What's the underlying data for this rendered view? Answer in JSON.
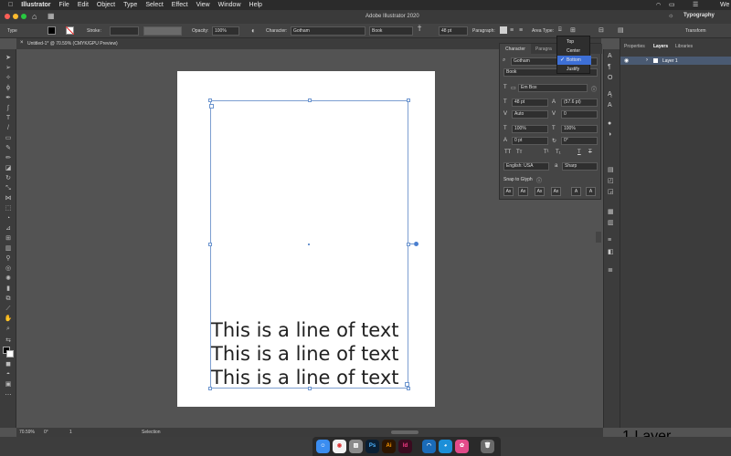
{
  "menubar": {
    "app": "Illustrator",
    "items": [
      "File",
      "Edit",
      "Object",
      "Type",
      "Select",
      "Effect",
      "View",
      "Window",
      "Help"
    ],
    "workspace": "Typography",
    "right_end": "We"
  },
  "titlebar": {
    "title": "Adobe Illustrator 2020"
  },
  "controlbar": {
    "type_label": "Type",
    "stroke_label": "Stroke:",
    "opacity_label": "Opacity:",
    "opacity_value": "100%",
    "character_label": "Character:",
    "font": "Gotham",
    "font_style": "Book",
    "font_size": "48 pt",
    "paragraph_label": "Paragraph:",
    "area_type_label": "Area Type:",
    "transform_label": "Transform"
  },
  "document": {
    "tab_title": "Untitled-1* @ 70.59% (CMYK/GPU Preview)",
    "text_lines": [
      "This is a line of text",
      "This is a line of text",
      "This is a line of text"
    ]
  },
  "dropdown": {
    "items": [
      "Top",
      "Center",
      "Bottom",
      "Justify"
    ],
    "selected": "Bottom"
  },
  "character_panel": {
    "tab_character": "Character",
    "tab_paragraph": "Paragra",
    "font": "Gotham",
    "style": "Book",
    "em_box": "Em Box",
    "size": "48 pt",
    "leading": "(57.6 pt)",
    "kerning": "Auto",
    "tracking": "0",
    "vscale": "100%",
    "hscale": "100%",
    "baseline": "0 pt",
    "rotation": "0°",
    "language": "English: USA",
    "antialias": "Sharp",
    "snap_label": "Snap to Glyph",
    "typographic_caps": [
      "TT",
      "Tт",
      "T¹",
      "T₁",
      "T",
      "T"
    ],
    "glyph_buttons": [
      "Ax",
      "Ax",
      "Ax",
      "Ax",
      "A",
      "A"
    ]
  },
  "layers_panel": {
    "tabs": [
      "Properties",
      "Layers",
      "Libraries"
    ],
    "layer_name": "Layer 1",
    "footer": "1 Layer"
  },
  "statusbar": {
    "zoom": "70.59%",
    "rotation": "0°",
    "artboard": "1",
    "tool": "Selection"
  },
  "dock": {
    "apps": [
      "Finder",
      "Chrome",
      "Preview",
      "Ps",
      "Ai",
      "Id",
      "Edge",
      "Camo",
      "Photos",
      "Trash"
    ]
  },
  "colors": {
    "selection": "#6c95cf",
    "dropdown_highlight": "#3d6fd6",
    "illustrator_brand": "#ff9a00"
  }
}
